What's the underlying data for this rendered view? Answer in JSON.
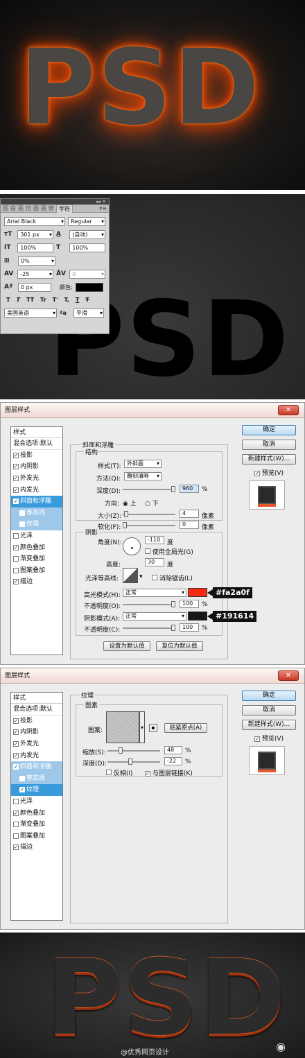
{
  "section1": {
    "text": "PSD"
  },
  "section2": {
    "text": "PSD",
    "panel": {
      "top_controls": "◂◂ ✕",
      "tabs": [
        "图",
        "段",
        "画",
        "仿",
        "图",
        "画",
        "修"
      ],
      "active_tab": "字符",
      "menu_icon": "▾≡",
      "font_family": "Arial Black",
      "font_style": "Regular",
      "size": "301 px",
      "leading": "(自动)",
      "vscale": "100%",
      "hscale": "100%",
      "tsume": "0%",
      "kerning": "-25",
      "tracking": "0",
      "baseline": "0 px",
      "color_label": "颜色:",
      "color_value": "#000000",
      "tf_buttons": [
        "T",
        "T",
        "TT",
        "Tr",
        "T'",
        "T,",
        "T",
        "T"
      ],
      "language": "美国英语",
      "aa_icon": "ªa",
      "antialias": "平滑"
    }
  },
  "dialog1": {
    "title": "图层样式",
    "close": "✕",
    "list_header": "样式",
    "blend": "混合选项:默认",
    "items": [
      {
        "label": "投影",
        "checked": "✓"
      },
      {
        "label": "内阴影",
        "checked": "✓"
      },
      {
        "label": "外发光",
        "checked": "✓"
      },
      {
        "label": "内发光",
        "checked": "✓"
      },
      {
        "label": "斜面和浮雕",
        "checked": "✓"
      },
      {
        "label": "等高线",
        "checked": ""
      },
      {
        "label": "纹理",
        "checked": ""
      },
      {
        "label": "光泽",
        "checked": ""
      },
      {
        "label": "颜色叠加",
        "checked": "✓"
      },
      {
        "label": "渐变叠加",
        "checked": ""
      },
      {
        "label": "图案叠加",
        "checked": ""
      },
      {
        "label": "描边",
        "checked": "✓"
      }
    ],
    "buttons": {
      "ok": "确定",
      "cancel": "取消",
      "new_style": "新建样式(W)...",
      "preview": "预览(V)"
    },
    "section_title": "斜面和浮雕",
    "structure": {
      "title": "结构",
      "style_label": "样式(T):",
      "style_value": "外斜面",
      "technique_label": "方法(Q):",
      "technique_value": "雕刻清晰",
      "depth_label": "深度(D):",
      "depth_value": "960",
      "depth_unit": "%",
      "direction_label": "方向:",
      "dir_up": "上",
      "dir_down": "下",
      "size_label": "大小(Z):",
      "size_value": "4",
      "size_unit": "像素",
      "soften_label": "软化(F):",
      "soften_value": "0",
      "soften_unit": "像素"
    },
    "shading": {
      "title": "阴影",
      "angle_label": "角度(N):",
      "angle_value": "-110",
      "angle_unit": "度",
      "global_light": "使用全局光(G)",
      "altitude_label": "高度:",
      "altitude_value": "30",
      "altitude_unit": "度",
      "gloss_label": "光泽等高线:",
      "antialias": "消除锯齿(L)",
      "highlight_label": "高光模式(H):",
      "highlight_mode": "正常",
      "highlight_color": "#fa2a0f",
      "highlight_hex": "#fa2a0f",
      "hl_opacity_label": "不透明度(O):",
      "hl_opacity": "100",
      "pct": "%",
      "shadow_label": "阴影模式(A):",
      "shadow_mode": "正常",
      "shadow_color": "#191614",
      "shadow_hex": "#191614",
      "sh_opacity_label": "不透明度(C):",
      "sh_opacity": "100"
    },
    "default_btns": {
      "set": "设置为默认值",
      "reset": "复位为默认值"
    }
  },
  "dialog2": {
    "title": "图层样式",
    "close": "✕",
    "list_header": "样式",
    "blend": "混合选项:默认",
    "items": [
      {
        "label": "投影",
        "checked": "✓"
      },
      {
        "label": "内阴影",
        "checked": "✓"
      },
      {
        "label": "外发光",
        "checked": "✓"
      },
      {
        "label": "内发光",
        "checked": "✓"
      },
      {
        "label": "斜面和浮雕",
        "checked": "✓"
      },
      {
        "label": "等高线",
        "checked": ""
      },
      {
        "label": "纹理",
        "checked": "✓"
      },
      {
        "label": "光泽",
        "checked": ""
      },
      {
        "label": "颜色叠加",
        "checked": "✓"
      },
      {
        "label": "渐变叠加",
        "checked": ""
      },
      {
        "label": "图案叠加",
        "checked": ""
      },
      {
        "label": "描边",
        "checked": "✓"
      }
    ],
    "buttons": {
      "ok": "确定",
      "cancel": "取消",
      "new_style": "新建样式(W)...",
      "preview": "预览(V)"
    },
    "section_title": "纹理",
    "elements": {
      "title": "图素",
      "pattern_label": "图案:",
      "snap_btn": "贴紧原点(A)",
      "scale_label": "缩放(S):",
      "scale_value": "48",
      "pct": "%",
      "depth_label": "深度(D):",
      "depth_value": "-22",
      "invert": "反相(I)",
      "link": "与图层链接(K)"
    }
  },
  "section5": {
    "text": "PSD"
  },
  "credit": "@优秀网页设计",
  "weibo_icon": "weibo-icon"
}
